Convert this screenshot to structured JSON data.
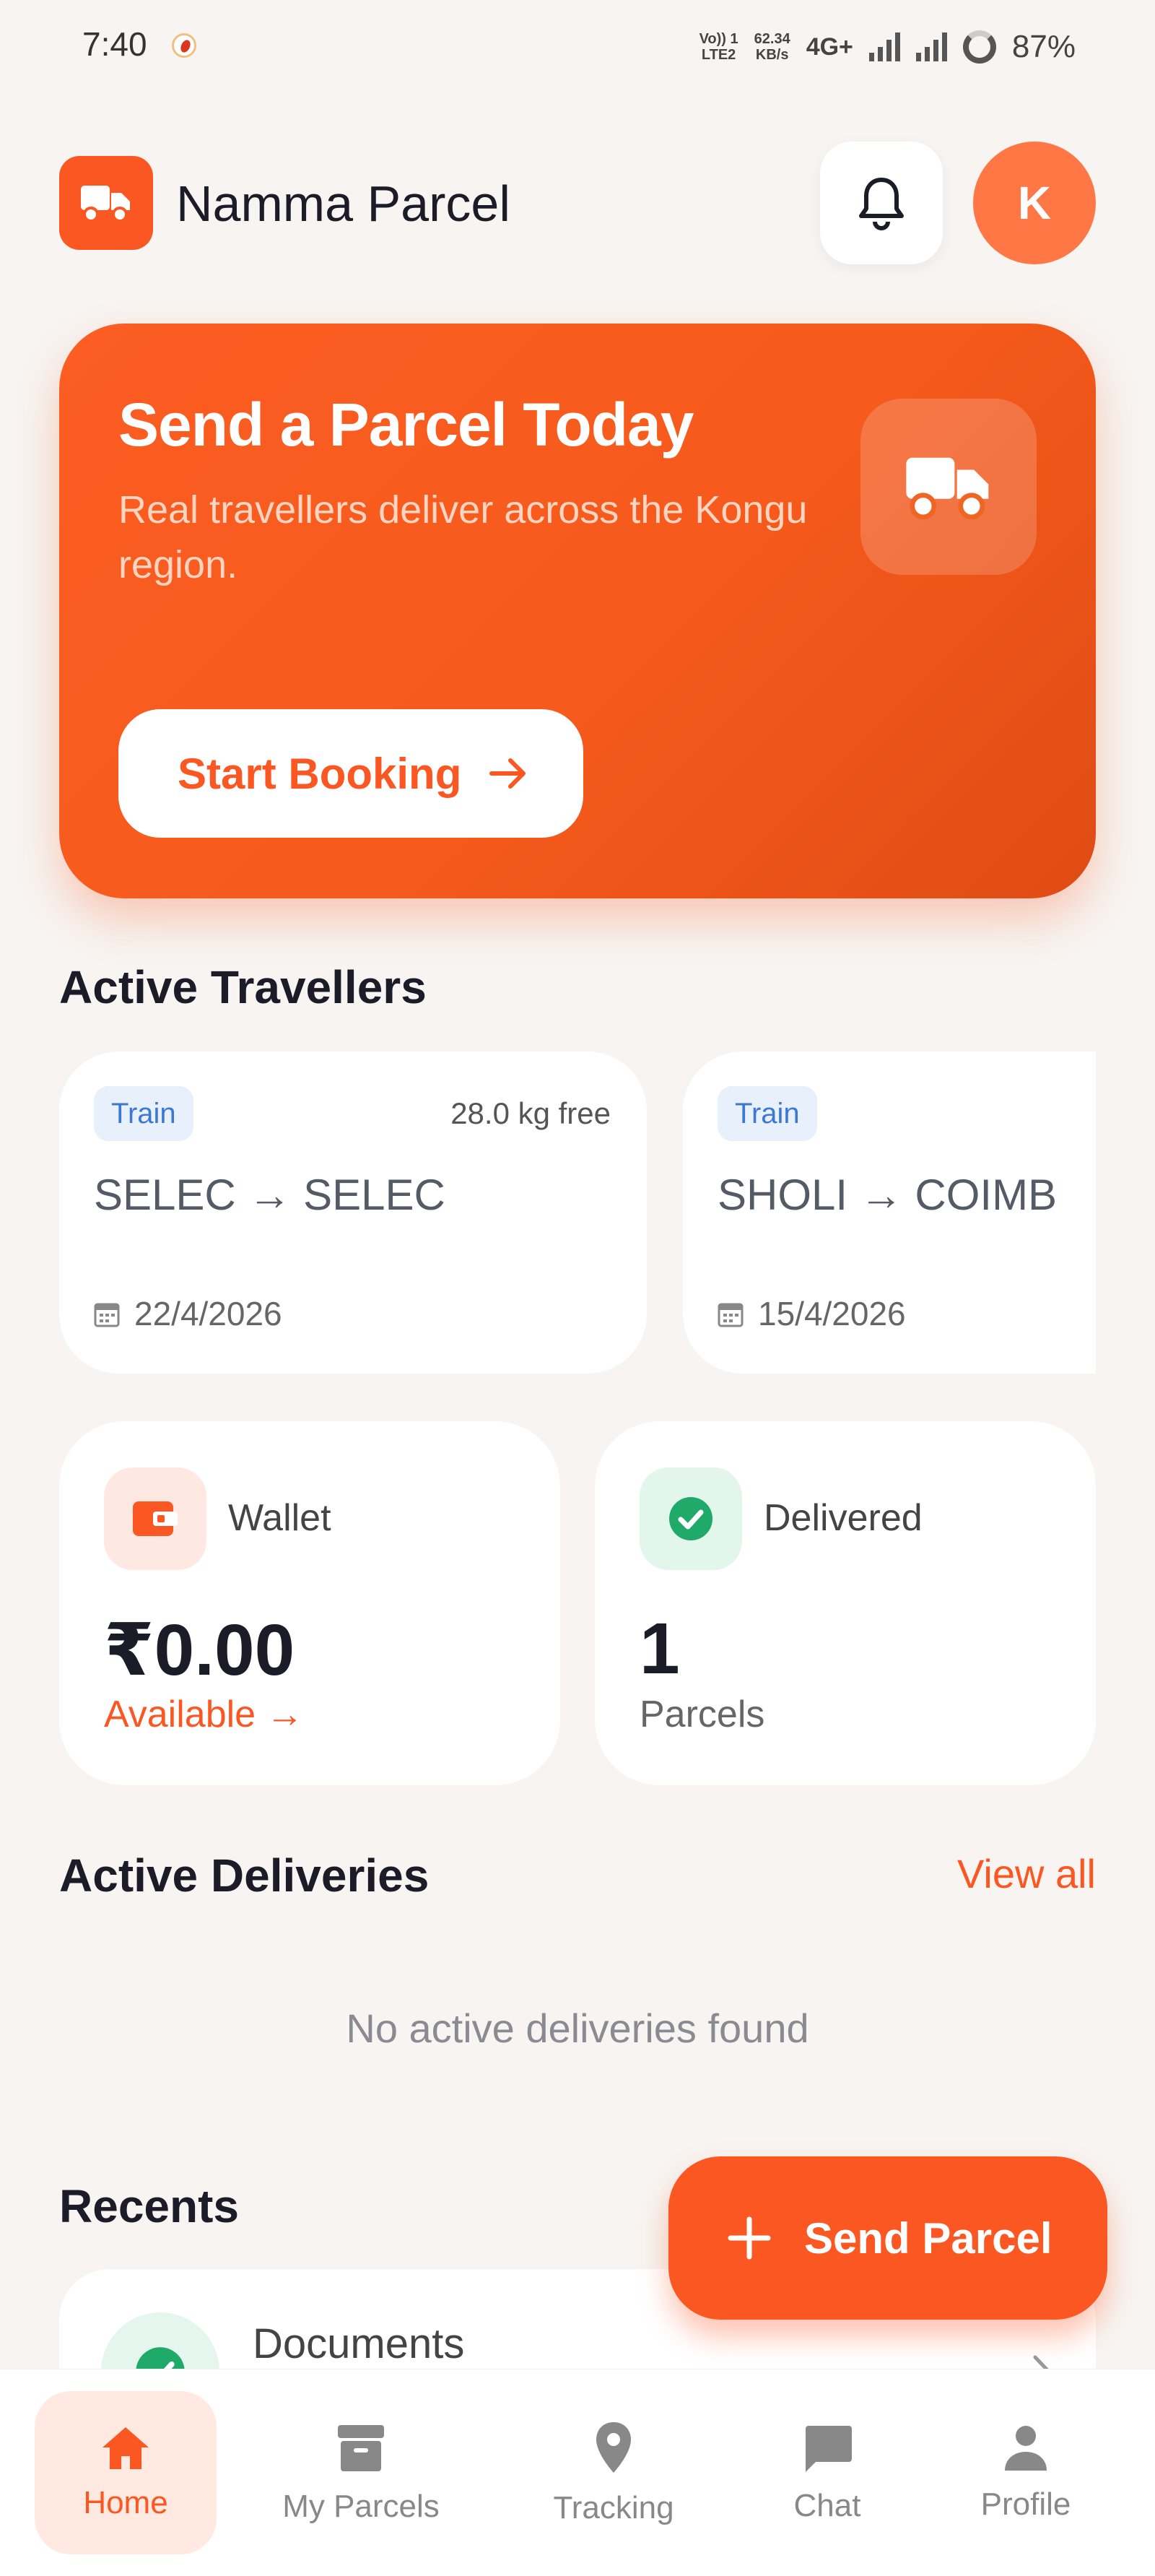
{
  "status_bar": {
    "time": "7:40",
    "network_top": "Vo)) 1",
    "network_bottom": "LTE2",
    "speed_value": "62.34",
    "speed_unit": "KB/s",
    "network_type": "4G+",
    "battery": "87%"
  },
  "header": {
    "app_name": "Namma Parcel",
    "logo_icon": "truck-icon",
    "notification_icon": "bell-icon",
    "avatar_initial": "K"
  },
  "hero": {
    "title": "Send a Parcel Today",
    "subtitle": "Real travellers deliver across the Kongu region.",
    "button_label": "Start Booking",
    "icon": "truck-icon"
  },
  "active_travellers": {
    "title": "Active Travellers",
    "cards": [
      {
        "mode": "Train",
        "free_weight": "28.0 kg free",
        "from": "SELEC",
        "to": "SELEC",
        "date": "22/4/2026"
      },
      {
        "mode": "Train",
        "free_weight": "",
        "from": "SHOLI",
        "to": "COIMB",
        "date": "15/4/2026"
      }
    ]
  },
  "stats": {
    "wallet": {
      "label": "Wallet",
      "amount": "₹0.00",
      "link": "Available",
      "icon": "wallet-icon"
    },
    "delivered": {
      "label": "Delivered",
      "count": "1",
      "unit": "Parcels",
      "icon": "check-circle-icon"
    }
  },
  "active_deliveries": {
    "title": "Active Deliveries",
    "view_all": "View all",
    "empty_message": "No active deliveries found"
  },
  "recents": {
    "title": "Recents",
    "items": [
      {
        "title": "Documents",
        "icon": "check-circle-icon"
      }
    ]
  },
  "fab": {
    "label": "Send Parcel",
    "icon": "plus-icon"
  },
  "bottom_nav": {
    "items": [
      {
        "label": "Home",
        "icon": "home-icon",
        "active": true
      },
      {
        "label": "My Parcels",
        "icon": "archive-icon",
        "active": false
      },
      {
        "label": "Tracking",
        "icon": "location-pin-icon",
        "active": false
      },
      {
        "label": "Chat",
        "icon": "chat-icon",
        "active": false
      },
      {
        "label": "Profile",
        "icon": "person-icon",
        "active": false
      }
    ]
  },
  "colors": {
    "accent": "#fb5722",
    "background": "#f7f4f1",
    "badge_blue": "#3a78d4",
    "success_green": "#1faa6a"
  }
}
